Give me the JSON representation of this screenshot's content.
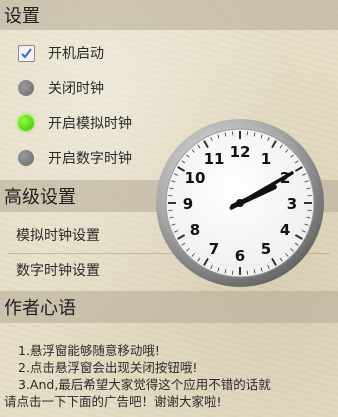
{
  "settings": {
    "title": "设置",
    "items": [
      {
        "label": "开机启动",
        "state": "checked"
      },
      {
        "label": "关闭时钟",
        "state": "off"
      },
      {
        "label": "开启模拟时钟",
        "state": "on"
      },
      {
        "label": "开启数字时钟",
        "state": "off"
      }
    ]
  },
  "advanced": {
    "title": "高级设置",
    "items": [
      {
        "label": "模拟时钟设置"
      },
      {
        "label": "数字时钟设置"
      }
    ]
  },
  "author": {
    "title": "作者心语",
    "lines": [
      " 1.悬浮窗能够随意移动哦!",
      " 2.点击悬浮窗会出现关闭按钮哦!",
      " 3.And,最后希望大家觉得这个应用不错的话就",
      "请点击一下下面的广告吧！谢谢大家啦!"
    ]
  },
  "clock": {
    "numbers": [
      "12",
      "1",
      "2",
      "3",
      "4",
      "5",
      "6",
      "7",
      "8",
      "9",
      "10",
      "11"
    ],
    "hour": 2,
    "minute": 10,
    "colors": {
      "face": "#ffffff",
      "ring": "#8c8c8c",
      "text": "#111111",
      "hands": "#111111"
    }
  }
}
